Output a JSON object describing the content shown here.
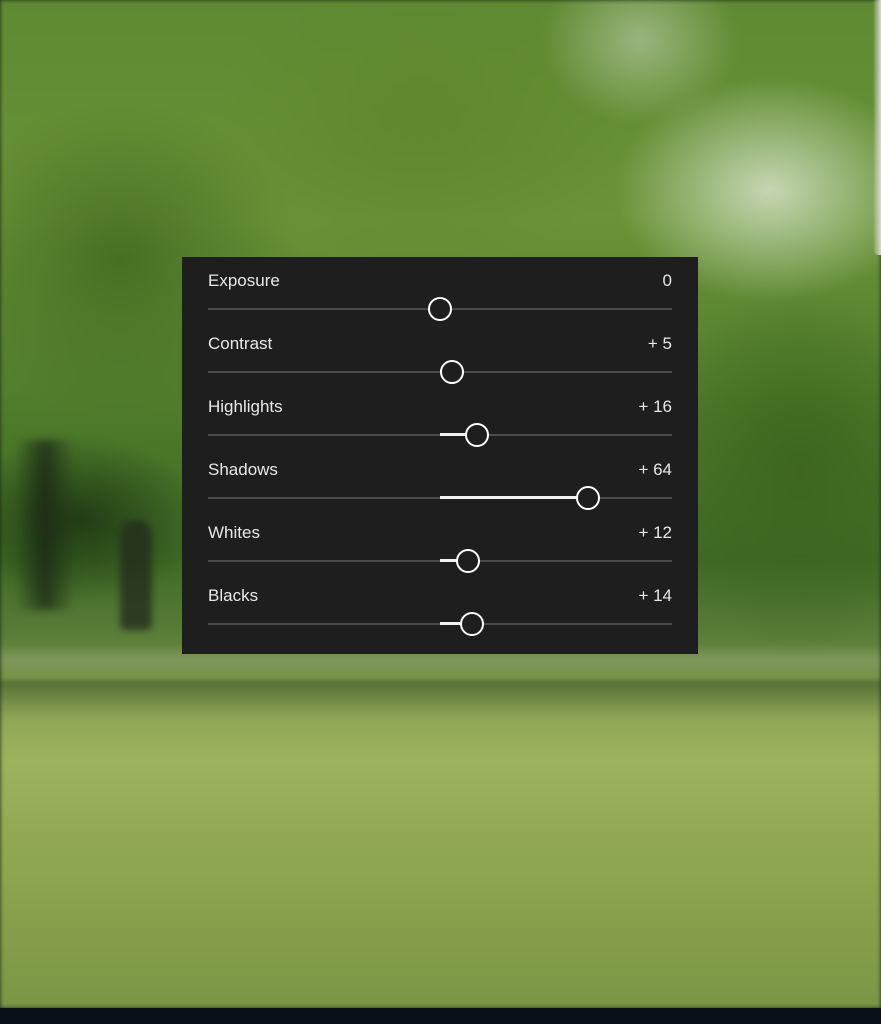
{
  "panel": {
    "sliders": [
      {
        "label": "Exposure",
        "value_text": "0",
        "value": 0
      },
      {
        "label": "Contrast",
        "value_text": "+ 5",
        "value": 5
      },
      {
        "label": "Highlights",
        "value_text": "+ 16",
        "value": 16
      },
      {
        "label": "Shadows",
        "value_text": "+ 64",
        "value": 64
      },
      {
        "label": "Whites",
        "value_text": "+ 12",
        "value": 12
      },
      {
        "label": "Blacks",
        "value_text": "+ 14",
        "value": 14
      }
    ],
    "range": [
      -100,
      100
    ]
  },
  "colors": {
    "panel_bg": "#1e1e1e",
    "track": "#4a4a4a",
    "fill": "#f2f2f2",
    "knob": "#ffffff",
    "text": "#e8e8e8"
  }
}
